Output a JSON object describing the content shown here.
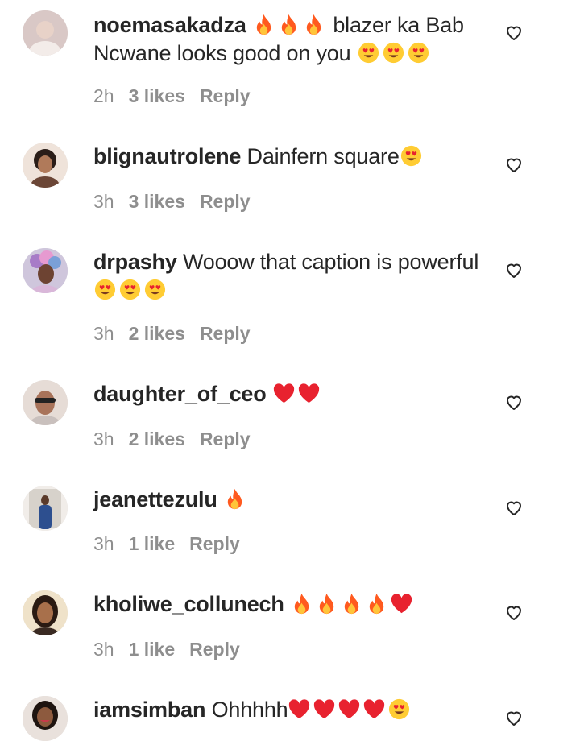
{
  "comments": [
    {
      "username": "noemasakadza",
      "text_before": "",
      "text": "blazer ka Bab Ncwane looks good on you",
      "lead_emojis": [
        "fire",
        "fire",
        "fire"
      ],
      "trail_emojis": [
        "heart-eyes",
        "heart-eyes",
        "heart-eyes"
      ],
      "time": "2h",
      "likes": "3 likes",
      "reply": "Reply"
    },
    {
      "username": "blignautrolene",
      "text": "Dainfern square",
      "trail_emojis": [
        "heart-eyes"
      ],
      "time": "3h",
      "likes": "3 likes",
      "reply": "Reply"
    },
    {
      "username": "drpashy",
      "text": "Wooow that caption is powerful",
      "trail_emojis": [
        "heart-eyes",
        "heart-eyes",
        "heart-eyes"
      ],
      "time": "3h",
      "likes": "2 likes",
      "reply": "Reply"
    },
    {
      "username": "daughter_of_ceo",
      "text": "",
      "trail_emojis": [
        "red-heart",
        "red-heart"
      ],
      "time": "3h",
      "likes": "2 likes",
      "reply": "Reply"
    },
    {
      "username": "jeanettezulu",
      "text": "",
      "trail_emojis": [
        "fire"
      ],
      "time": "3h",
      "likes": "1 like",
      "reply": "Reply"
    },
    {
      "username": "kholiwe_collunech",
      "text": "",
      "trail_emojis": [
        "fire",
        "fire",
        "fire",
        "fire",
        "red-heart"
      ],
      "time": "3h",
      "likes": "1 like",
      "reply": "Reply"
    },
    {
      "username": "iamsimban",
      "text": "Ohhhhh",
      "trail_emojis": [
        "red-heart",
        "red-heart",
        "red-heart",
        "red-heart",
        "heart-eyes"
      ],
      "time": "",
      "likes": "",
      "reply": ""
    }
  ],
  "colors": {
    "text": "#262626",
    "meta": "#8e8e8e",
    "fire": "#ff5a1f",
    "heart": "#e8222f",
    "face": "#ffcc33"
  }
}
